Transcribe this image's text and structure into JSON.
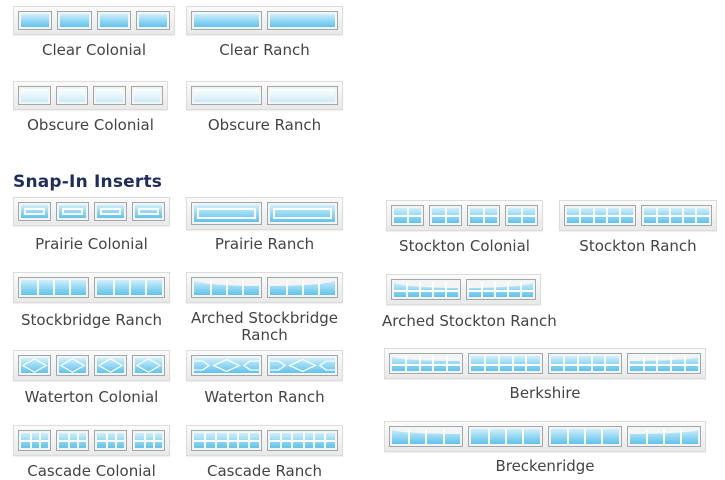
{
  "section_heading": "Snap-In Inserts",
  "items": {
    "clear_colonial": "Clear Colonial",
    "clear_ranch": "Clear Ranch",
    "obscure_colonial": "Obscure Colonial",
    "obscure_ranch": "Obscure Ranch",
    "prairie_colonial": "Prairie Colonial",
    "prairie_ranch": "Prairie Ranch",
    "stockton_colonial": "Stockton Colonial",
    "stockton_ranch": "Stockton Ranch",
    "stockbridge_ranch": "Stockbridge Ranch",
    "arched_stockbridge_ranch": "Arched Stockbridge Ranch",
    "arched_stockton_ranch": "Arched Stockton Ranch",
    "waterton_colonial": "Waterton Colonial",
    "waterton_ranch": "Waterton Ranch",
    "berkshire": "Berkshire",
    "cascade_colonial": "Cascade Colonial",
    "cascade_ranch": "Cascade Ranch",
    "breckenridge": "Breckenridge"
  },
  "colors": {
    "heading": "#1f2d5c",
    "glass": "#8fd6f3",
    "obscure_glass": "#e6f6fc"
  }
}
